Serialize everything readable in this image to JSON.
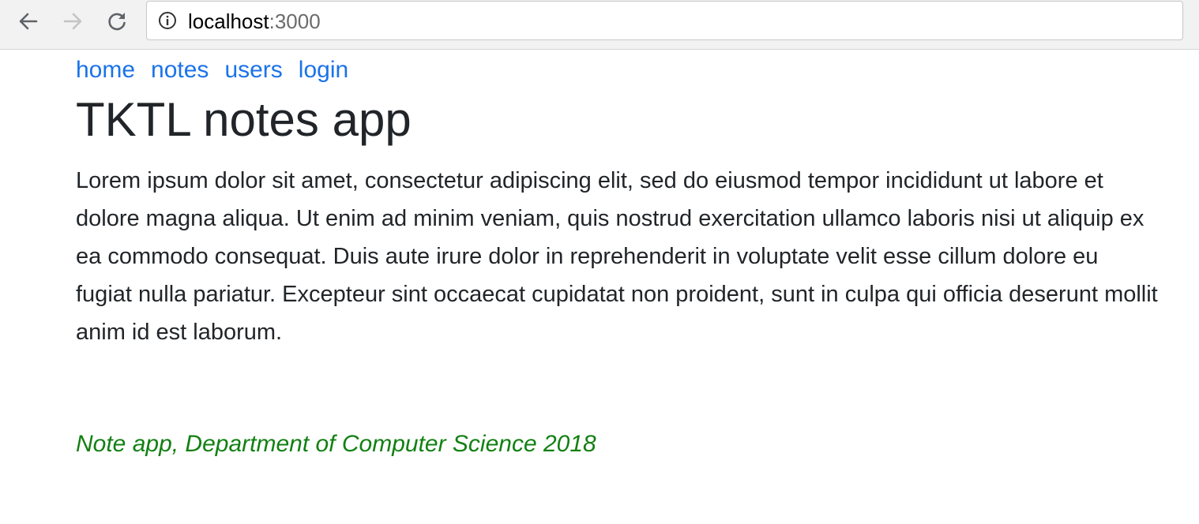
{
  "browser": {
    "back_icon": "arrow-left-icon",
    "forward_icon": "arrow-right-icon",
    "reload_icon": "reload-icon",
    "info_icon": "info-circle-icon",
    "url_host": "localhost",
    "url_port": ":3000"
  },
  "nav": {
    "items": [
      {
        "label": "home"
      },
      {
        "label": "notes"
      },
      {
        "label": "users"
      },
      {
        "label": "login"
      }
    ],
    "link_color": "#1a73e8"
  },
  "main": {
    "title": "TKTL notes app",
    "body": "Lorem ipsum dolor sit amet, consectetur adipiscing elit, sed do eiusmod tempor incididunt ut labore et dolore magna aliqua. Ut enim ad minim veniam, quis nostrud exercitation ullamco laboris nisi ut aliquip ex ea commodo consequat. Duis aute irure dolor in reprehenderit in voluptate velit esse cillum dolore eu fugiat nulla pariatur. Excepteur sint occaecat cupidatat non proident, sunt in culpa qui officia deserunt mollit anim id est laborum."
  },
  "footer": {
    "text": "Note app, Department of Computer Science 2018",
    "color": "#128012"
  }
}
